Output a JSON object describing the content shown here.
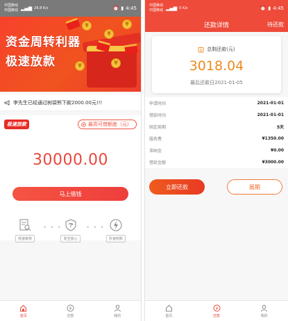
{
  "colors": {
    "brand_red": "#ee4b3a",
    "amount_red": "#e8473b",
    "amount_orange": "#ee8a1c",
    "status_gray": "#7a7a7a"
  },
  "left": {
    "status": {
      "carrier1": "中国移动",
      "carrier2": "中国移动",
      "speed": "26.8 K/s",
      "time": "4:45"
    },
    "banner": {
      "line1": "资金周转利器",
      "line2": "极速放款"
    },
    "notice": "李先生已经通过树袋熊下款2000.00元!!!",
    "card": {
      "tag": "极速放款",
      "max_label": "最高可借额度（元）",
      "amount": "30000.00",
      "borrow_button": "马上借钱"
    },
    "steps": [
      {
        "label": "快速审核",
        "icon": "document-search-icon"
      },
      {
        "label": "安全放心",
        "icon": "shield-icon"
      },
      {
        "label": "秒速到账",
        "icon": "lightning-icon"
      }
    ],
    "tabs": [
      {
        "label": "首页",
        "icon": "home-icon",
        "active": true
      },
      {
        "label": "还款",
        "icon": "repay-icon",
        "active": false
      },
      {
        "label": "我的",
        "icon": "user-icon",
        "active": false
      }
    ]
  },
  "right": {
    "status": {
      "carrier1": "中国移动",
      "carrier2": "中国移动",
      "speed": "0 K/s",
      "time": "4:45"
    },
    "nav": {
      "title": "还款详情",
      "right": "待还款"
    },
    "summary": {
      "label": "总剩还款(元)",
      "amount": "3018.04",
      "due": "最后还款日2021-01-05"
    },
    "rows": [
      {
        "label": "申请时间",
        "value": "2021-01-01"
      },
      {
        "label": "借款时间",
        "value": "2021-01-01"
      },
      {
        "label": "固定周期",
        "value": "5天"
      },
      {
        "label": "服务费",
        "value": "¥1350.00"
      },
      {
        "label": "滞纳金",
        "value": "¥0.00"
      },
      {
        "label": "借款金额",
        "value": "¥3000.00"
      }
    ],
    "buttons": {
      "pay": "立即还款",
      "extend": "展期"
    },
    "tabs": [
      {
        "label": "首页",
        "icon": "home-icon",
        "active": false
      },
      {
        "label": "还款",
        "icon": "repay-icon",
        "active": true
      },
      {
        "label": "我的",
        "icon": "user-icon",
        "active": false
      }
    ]
  }
}
